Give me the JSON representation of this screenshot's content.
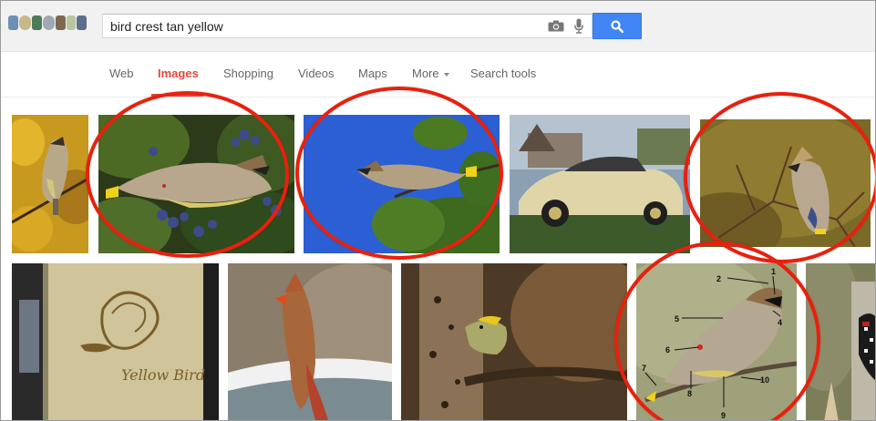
{
  "search": {
    "query": "bird crest tan yellow"
  },
  "tabs": [
    {
      "label": "Web"
    },
    {
      "label": "Images"
    },
    {
      "label": "Shopping"
    },
    {
      "label": "Videos"
    },
    {
      "label": "Maps"
    },
    {
      "label": "More"
    },
    {
      "label": "Search tools"
    }
  ],
  "colors": {
    "accent": "#dd4b39",
    "search_button": "#4285f4",
    "annotation_circle": "#e8200d"
  },
  "icons": [
    "doodle-logo",
    "camera-icon",
    "microphone-icon",
    "magnifier-icon"
  ],
  "results": {
    "row1": [
      {
        "subject": "cedar waxwing in yellow leaves",
        "circled": false
      },
      {
        "subject": "cedar waxwing eating berries",
        "circled": true
      },
      {
        "subject": "cedar waxwing on branch against blue sky",
        "circled": true
      },
      {
        "subject": "cream car",
        "circled": false
      },
      {
        "subject": "cedar waxwing on twig",
        "circled": true
      }
    ],
    "row2": [
      {
        "subject": "Yellow Bird car decal",
        "circled": false,
        "caption": "Yellow Bird"
      },
      {
        "subject": "female cardinal in snow",
        "circled": false
      },
      {
        "subject": "kinglet on branch by tree trunk",
        "circled": false
      },
      {
        "subject": "labeled cedar waxwing diagram",
        "circled": true,
        "labels": [
          "2",
          "1",
          "4",
          "5",
          "6",
          "7",
          "8",
          "9",
          "10"
        ]
      },
      {
        "subject": "partial woodpecker image",
        "circled": false
      }
    ]
  }
}
